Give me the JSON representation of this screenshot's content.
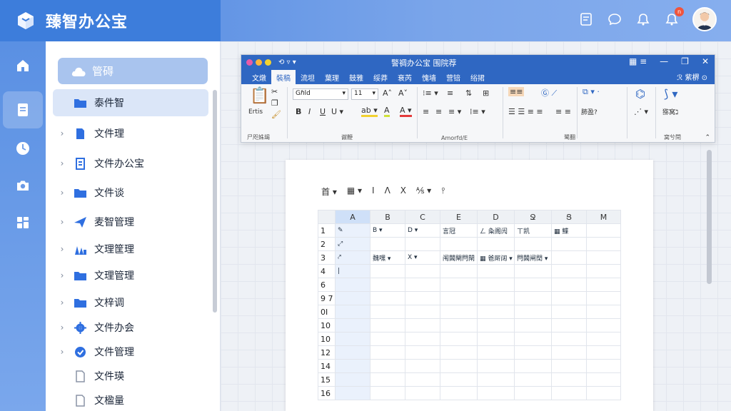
{
  "app": {
    "name": "臻智办公宝",
    "notification_count": "n"
  },
  "sidebar": {
    "cloud_label": "管碍",
    "items": [
      {
        "label": "泰件智",
        "icon": "folder-icon",
        "color": "#2f6fe0",
        "chevron": false,
        "selected": true
      },
      {
        "label": "文件理",
        "icon": "document-icon",
        "color": "#2f6fe0",
        "chevron": true
      },
      {
        "label": "文件办公宝",
        "icon": "notes-icon",
        "color": "#2f6fe0",
        "chevron": true
      },
      {
        "label": "文件谈",
        "icon": "folder-icon",
        "color": "#2f6fe0",
        "chevron": true
      },
      {
        "label": "麦智管理",
        "icon": "send-icon",
        "color": "#2f6fe0",
        "chevron": true
      },
      {
        "label": "文理筐理",
        "icon": "people-icon",
        "color": "#2f6fe0",
        "chevron": true
      },
      {
        "label": "文理管理",
        "icon": "folder-icon",
        "color": "#2f6fe0",
        "chevron": true
      },
      {
        "label": "文梓调",
        "icon": "folder-icon",
        "color": "#2f6fe0",
        "chevron": true
      },
      {
        "label": "文件办会",
        "icon": "gear-icon",
        "color": "#2f6fe0",
        "chevron": true
      },
      {
        "label": "文件管理",
        "icon": "check-circle-icon",
        "color": "#2f6fe0",
        "chevron": true
      },
      {
        "label": "文件瑛",
        "icon": "file-outline-icon",
        "color": "#8a94a6",
        "chevron": false
      },
      {
        "label": "文楹量",
        "icon": "file-outline-icon",
        "color": "#8a94a6",
        "chevron": false
      }
    ]
  },
  "ribbon": {
    "title": "警禂办公宝  围院荐",
    "tabs": [
      "文燉",
      "裝稿",
      "流坦",
      "葉理",
      "鼓雅",
      "绥莽",
      "衰芮",
      "愧墙",
      "营锫",
      "绤捃"
    ],
    "active_tab": 1,
    "right_label": "ℛ 紫楐 ⊙",
    "groups": [
      "尸咫姝朅",
      "谳鞭",
      "Amorfd/E",
      "鹭翻",
      "窝兮閈"
    ],
    "font_name": "Gℏld",
    "font_size": "11",
    "paste_label": "Ertis",
    "style_label": "肺盈?",
    "style2_label": "猕窝ℷ"
  },
  "document": {
    "mini_toolbar": [
      "首 ▾",
      "▦ ▾",
      "I",
      "Λ",
      "X",
      "⅍ ▾",
      "⫯"
    ],
    "columns": [
      "",
      "A",
      "B",
      "C",
      "E",
      "D",
      "Ջ",
      "Ց",
      "M"
    ],
    "rows": [
      {
        "num": "1",
        "cells": [
          "✎",
          "B ▾",
          "D ▾",
          "言冠",
          "ㄥ 粂阁闶",
          "ㄒ凯",
          "▦ 鰈"
        ]
      },
      {
        "num": "2",
        "cells": [
          "⤢",
          "",
          "",
          "",
          "",
          "",
          ""
        ]
      },
      {
        "num": "3",
        "cells": [
          "⤤",
          "魏嘿 ▾",
          "X ▾",
          "闱閪閘閂閛",
          "▦ 爸厛阔 ▾",
          "閂閪闸閏 ▾",
          ""
        ]
      },
      {
        "num": "4",
        "cells": [
          "|",
          "",
          "",
          "",
          "",
          "",
          ""
        ]
      },
      {
        "num": "6",
        "cells": [
          "",
          "",
          "",
          "",
          "",
          "",
          ""
        ]
      },
      {
        "num": "9\n7",
        "cells": [
          "",
          "",
          "",
          "",
          "",
          "",
          ""
        ]
      },
      {
        "num": "0I",
        "cells": [
          "",
          "",
          "",
          "",
          "",
          "",
          ""
        ]
      },
      {
        "num": "10",
        "cells": [
          "",
          "",
          "",
          "",
          "",
          "",
          ""
        ]
      },
      {
        "num": "10",
        "cells": [
          "",
          "",
          "",
          "",
          "",
          "",
          ""
        ]
      },
      {
        "num": "12",
        "cells": [
          "",
          "",
          "",
          "",
          "",
          "",
          ""
        ]
      },
      {
        "num": "14",
        "cells": [
          "",
          "",
          "",
          "",
          "",
          "",
          ""
        ]
      },
      {
        "num": "15",
        "cells": [
          "",
          "",
          "",
          "",
          "",
          "",
          ""
        ]
      },
      {
        "num": "16",
        "cells": [
          "",
          "",
          "",
          "",
          "",
          "",
          ""
        ]
      }
    ]
  },
  "colors": {
    "primary": "#3d7ddb",
    "ribbon": "#2f67c2",
    "badge": "#f0543c"
  }
}
